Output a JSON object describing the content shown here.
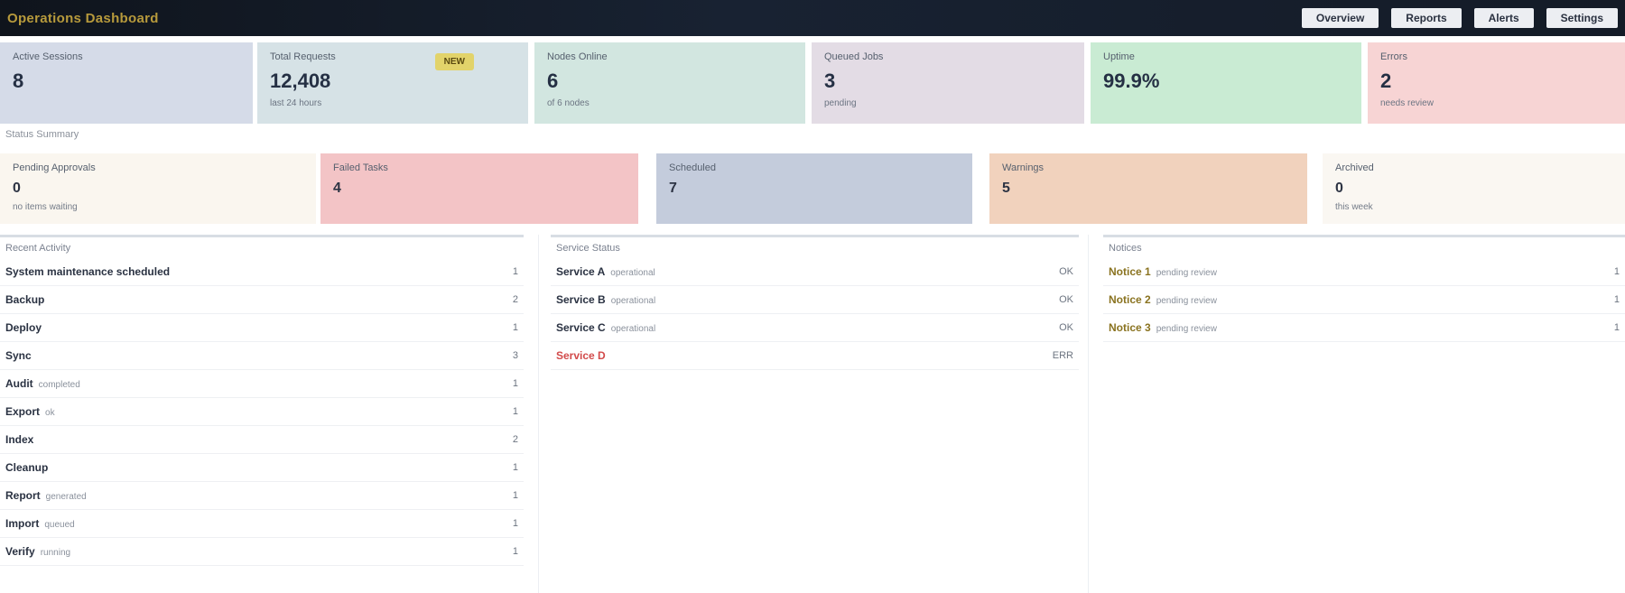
{
  "app": {
    "title": "Operations Dashboard"
  },
  "nav": [
    {
      "label": "Overview"
    },
    {
      "label": "Reports"
    },
    {
      "label": "Alerts"
    },
    {
      "label": "Settings"
    }
  ],
  "kpis": [
    {
      "label": "Active Sessions",
      "value": "8",
      "sub": "",
      "bg": "#d5dbe8"
    },
    {
      "label": "Total Requests",
      "value": "12,408",
      "sub": "last 24 hours",
      "badge": "NEW",
      "bg": "#d6e2e6"
    },
    {
      "label": "Nodes Online",
      "value": "6",
      "sub": "of 6 nodes",
      "bg": "#d2e6e0"
    },
    {
      "label": "Queued Jobs",
      "value": "3",
      "sub": "pending",
      "bg": "#e3dce5"
    },
    {
      "label": "Uptime",
      "value": "99.9%",
      "sub": "",
      "bg": "#c9ebd3"
    },
    {
      "label": "Errors",
      "value": "2",
      "sub": "needs review",
      "bg": "#f7d4d4"
    }
  ],
  "section_title": "Status Summary",
  "secondary": [
    {
      "label": "Pending Approvals",
      "value": "0",
      "sub": "no items waiting",
      "bg": "#faf6ef"
    },
    {
      "label": "Failed Tasks",
      "value": "4",
      "sub": "",
      "bg": "#f3c4c6"
    },
    {
      "label": "Scheduled",
      "value": "7",
      "sub": "",
      "bg": "#c4ccdc"
    },
    {
      "label": "Warnings",
      "value": "5",
      "sub": "",
      "bg": "#f1d2bd"
    },
    {
      "label": "Archived",
      "value": "0",
      "sub": "this week",
      "bg": "#faf7f2"
    }
  ],
  "lists": [
    {
      "title": "Recent Activity",
      "rows": [
        {
          "name": "System maintenance scheduled",
          "desc": "",
          "value": "1",
          "style": ""
        },
        {
          "name": "Backup",
          "desc": "",
          "value": "2",
          "style": ""
        },
        {
          "name": "Deploy",
          "desc": "",
          "value": "1",
          "style": ""
        },
        {
          "name": "Sync",
          "desc": "",
          "value": "3",
          "style": ""
        },
        {
          "name": "Audit",
          "desc": "completed",
          "value": "1",
          "style": ""
        },
        {
          "name": "Export",
          "desc": "ok",
          "value": "1",
          "style": ""
        },
        {
          "name": "Index",
          "desc": "",
          "value": "2",
          "style": ""
        },
        {
          "name": "Cleanup",
          "desc": "",
          "value": "1",
          "style": ""
        },
        {
          "name": "Report",
          "desc": "generated",
          "value": "1",
          "style": ""
        },
        {
          "name": "Import",
          "desc": "queued",
          "value": "1",
          "style": ""
        },
        {
          "name": "Verify",
          "desc": "running",
          "value": "1",
          "style": ""
        }
      ]
    },
    {
      "title": "Service Status",
      "rows": [
        {
          "name": "Service A",
          "desc": "operational",
          "value": "OK",
          "style": ""
        },
        {
          "name": "Service B",
          "desc": "operational",
          "value": "OK",
          "style": ""
        },
        {
          "name": "Service C",
          "desc": "operational",
          "value": "OK",
          "style": ""
        },
        {
          "name": "Service D",
          "desc": "",
          "value": "ERR",
          "style": "alert"
        }
      ]
    },
    {
      "title": "Notices",
      "rows": [
        {
          "name": "Notice 1",
          "desc": "pending review",
          "value": "1",
          "style": "warn"
        },
        {
          "name": "Notice 2",
          "desc": "pending review",
          "value": "1",
          "style": "warn"
        },
        {
          "name": "Notice 3",
          "desc": "pending review",
          "value": "1",
          "style": "warn"
        }
      ]
    }
  ]
}
